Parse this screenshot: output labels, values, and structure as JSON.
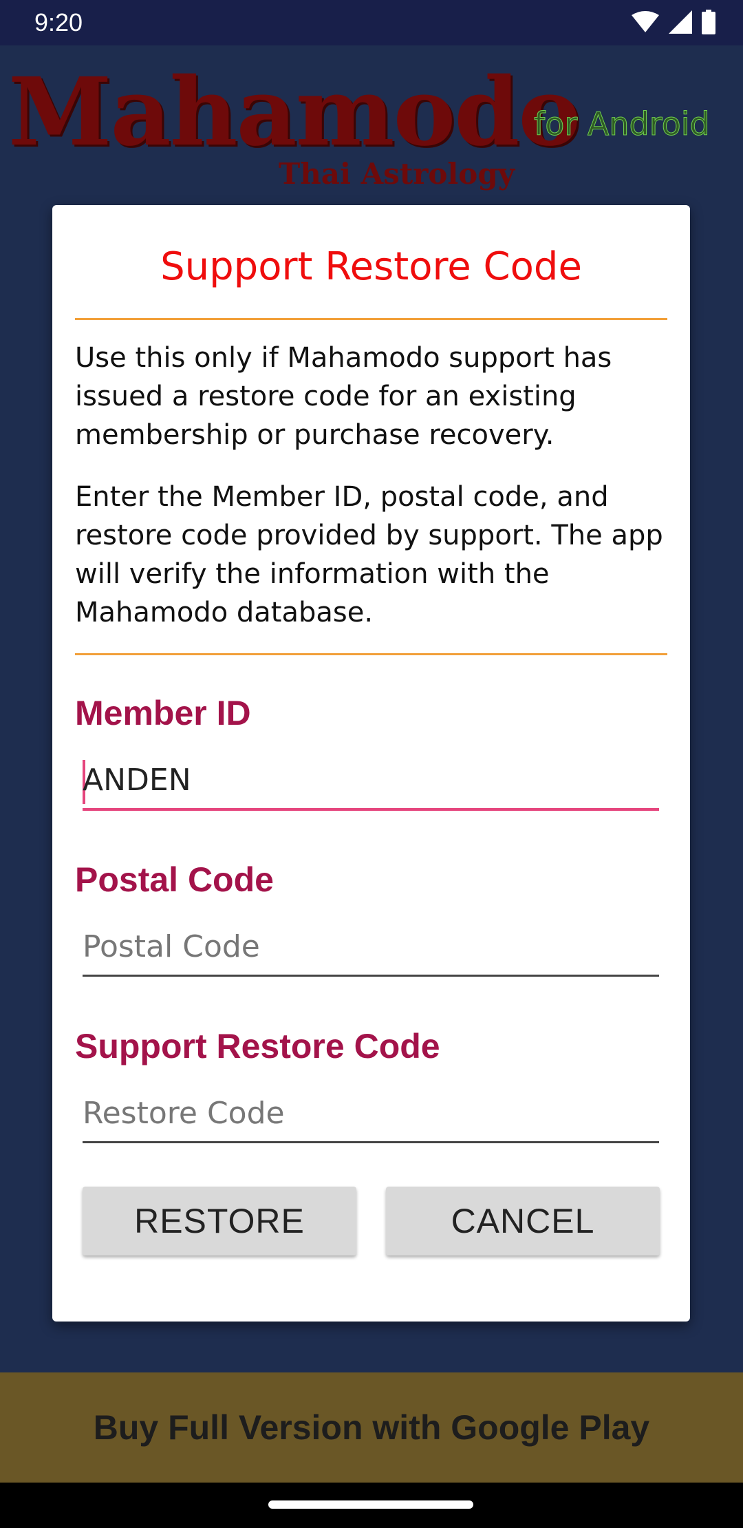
{
  "status_bar": {
    "time": "9:20"
  },
  "app": {
    "brand_title": "Mahamodo",
    "brand_subtitle": "Thai Astrology",
    "brand_platform": "for Android"
  },
  "dialog": {
    "title": "Support Restore Code",
    "paragraph_1": "Use this only if Mahamodo support has issued a restore code for an existing membership or purchase recovery.",
    "paragraph_2": "Enter the Member ID, postal code, and restore code provided by support. The app will verify the information with the Mahamodo database.",
    "member_id": {
      "label": "Member ID",
      "value": "ANDEN"
    },
    "postal_code": {
      "label": "Postal Code",
      "placeholder": "Postal Code",
      "value": ""
    },
    "restore_code": {
      "label": "Support Restore Code",
      "placeholder": "Restore Code",
      "value": ""
    },
    "restore_button": "RESTORE",
    "cancel_button": "CANCEL"
  },
  "banner": {
    "label": "Buy Full Version with Google Play"
  },
  "colors": {
    "title_red": "#ef0d0d",
    "label_maroon": "#a3134a",
    "divider_orange": "#f2a03a",
    "focus_pink": "#e5457d",
    "banner_gold": "#6a5726",
    "background_navy": "#1e2d4f"
  },
  "icons": [
    "wifi-icon",
    "cell-signal-icon",
    "battery-icon"
  ]
}
